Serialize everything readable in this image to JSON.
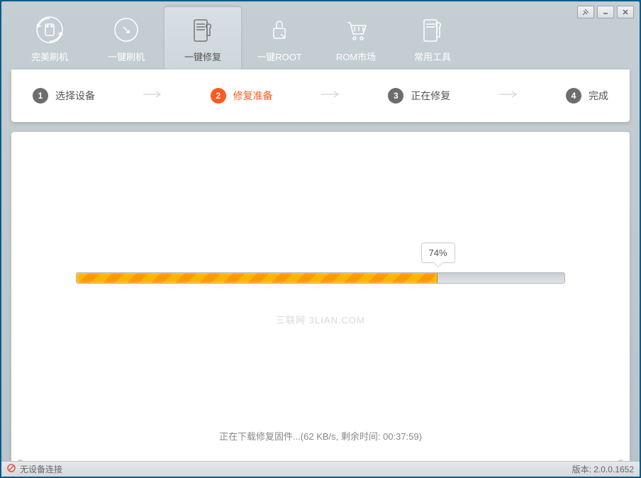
{
  "titlebar": {
    "pin": "⇱",
    "min": "—",
    "close": "✕"
  },
  "nav": {
    "items": [
      {
        "label": "完美刷机"
      },
      {
        "label": "一键刷机"
      },
      {
        "label": "一键修复"
      },
      {
        "label": "一键ROOT"
      },
      {
        "label": "ROM市场"
      },
      {
        "label": "常用工具"
      }
    ]
  },
  "steps": {
    "items": [
      {
        "num": "1",
        "label": "选择设备"
      },
      {
        "num": "2",
        "label": "修复准备"
      },
      {
        "num": "3",
        "label": "正在修复"
      },
      {
        "num": "4",
        "label": "完成"
      }
    ]
  },
  "progress": {
    "percent_label": "74%",
    "percent_value": 74
  },
  "watermark": "三联网 3LIAN.COM",
  "status_text": "正在下载修复固件...(62 KB/s, 剩余时间: 00:37:59)",
  "footer": {
    "device_status": "无设备连接",
    "version_label": "版本: 2.0.0.1652"
  }
}
